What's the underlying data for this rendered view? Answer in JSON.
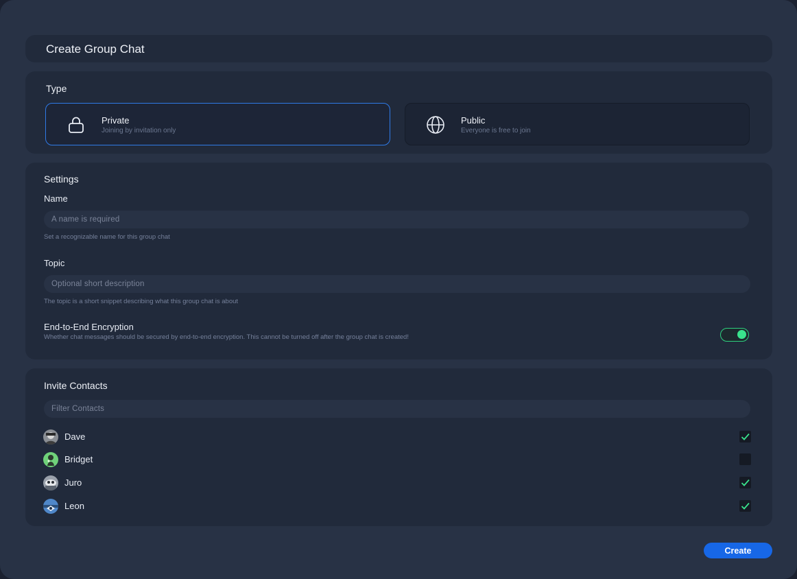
{
  "dialog": {
    "title": "Create Group Chat"
  },
  "type_section": {
    "label": "Type",
    "options": [
      {
        "title": "Private",
        "subtitle": "Joining by invitation only",
        "icon": "lock-icon",
        "selected": true
      },
      {
        "title": "Public",
        "subtitle": "Everyone is free to join",
        "icon": "globe-icon",
        "selected": false
      }
    ]
  },
  "settings": {
    "label": "Settings",
    "name": {
      "label": "Name",
      "placeholder": "A name is required",
      "value": "",
      "hint": "Set a recognizable name for this group chat"
    },
    "topic": {
      "label": "Topic",
      "placeholder": "Optional short description",
      "value": "",
      "hint": "The topic is a short snippet describing what this group chat is about"
    },
    "encryption": {
      "label": "End-to-End Encryption",
      "hint": "Whether chat messages should be secured by end-to-end encryption. This cannot be turned off after the group chat is created!",
      "enabled": true
    }
  },
  "contacts": {
    "label": "Invite Contacts",
    "filter_placeholder": "Filter Contacts",
    "items": [
      {
        "name": "Dave",
        "checked": true
      },
      {
        "name": "Bridget",
        "checked": false
      },
      {
        "name": "Juro",
        "checked": true
      },
      {
        "name": "Leon",
        "checked": true
      }
    ]
  },
  "actions": {
    "create_label": "Create"
  },
  "colors": {
    "accent": "#1767e6",
    "selected_border": "#2f7be8",
    "toggle_on": "#39e48d",
    "check": "#39e48d"
  }
}
